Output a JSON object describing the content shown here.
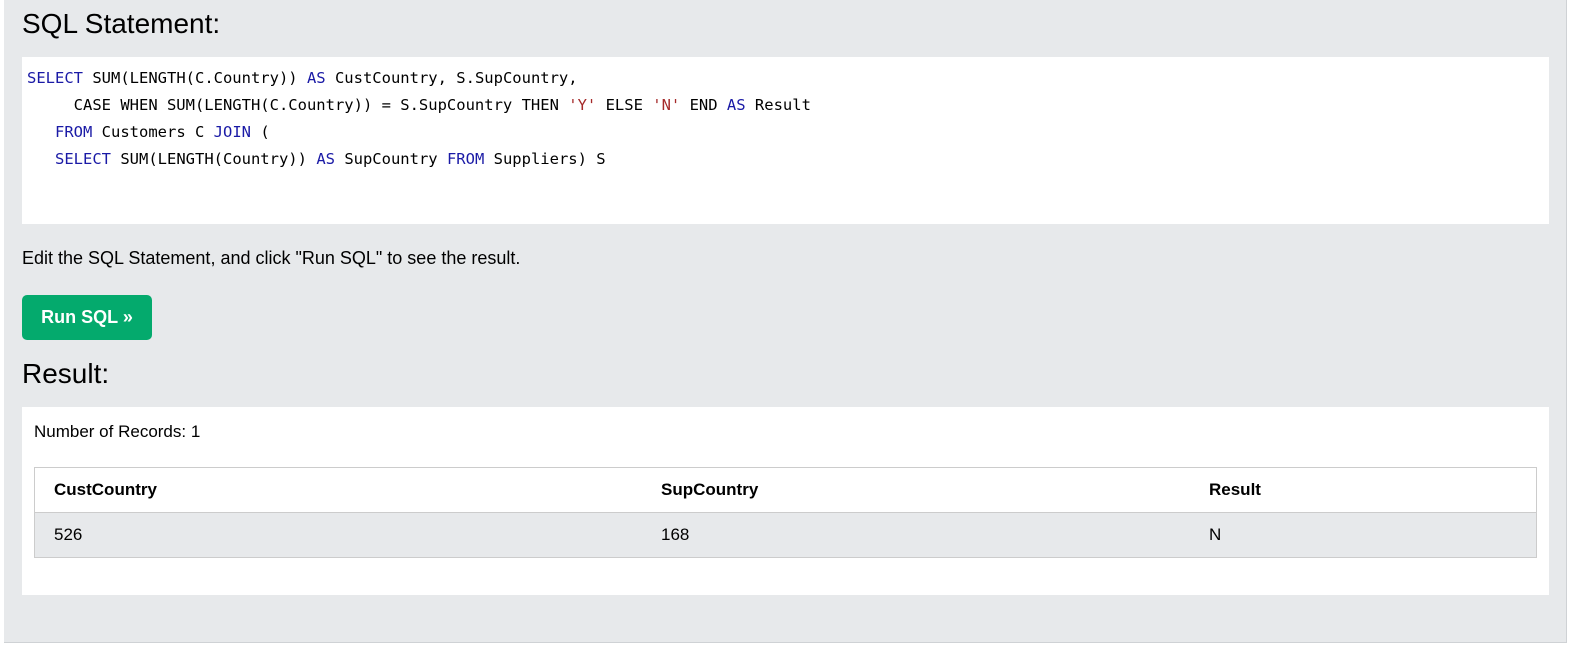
{
  "sql_section": {
    "title": "SQL Statement:",
    "code_lines": [
      [
        {
          "t": "SELECT",
          "k": "kw"
        },
        {
          "t": " SUM(LENGTH(C.Country)) ",
          "k": ""
        },
        {
          "t": "AS",
          "k": "kw"
        },
        {
          "t": " CustCountry, S.SupCountry,",
          "k": ""
        }
      ],
      [
        {
          "t": "     CASE WHEN SUM(LENGTH(C.Country)) = S.SupCountry THEN ",
          "k": ""
        },
        {
          "t": "'Y'",
          "k": "str"
        },
        {
          "t": " ELSE ",
          "k": ""
        },
        {
          "t": "'N'",
          "k": "str"
        },
        {
          "t": " END ",
          "k": ""
        },
        {
          "t": "AS",
          "k": "kw"
        },
        {
          "t": " Result",
          "k": ""
        }
      ],
      [
        {
          "t": "   ",
          "k": ""
        },
        {
          "t": "FROM",
          "k": "kw"
        },
        {
          "t": " Customers C ",
          "k": ""
        },
        {
          "t": "JOIN",
          "k": "kw"
        },
        {
          "t": " (",
          "k": ""
        }
      ],
      [
        {
          "t": "   ",
          "k": ""
        },
        {
          "t": "SELECT",
          "k": "kw"
        },
        {
          "t": " SUM(LENGTH(Country)) ",
          "k": ""
        },
        {
          "t": "AS",
          "k": "kw"
        },
        {
          "t": " SupCountry ",
          "k": ""
        },
        {
          "t": "FROM",
          "k": "kw"
        },
        {
          "t": " Suppliers) S",
          "k": ""
        }
      ]
    ]
  },
  "hint_text": "Edit the SQL Statement, and click \"Run SQL\" to see the result.",
  "run_button_label": "Run SQL »",
  "result_section": {
    "title": "Result:",
    "records_label": "Number of Records: 1",
    "columns": [
      "CustCountry",
      "SupCountry",
      "Result"
    ],
    "rows": [
      [
        "526",
        "168",
        "N"
      ]
    ]
  },
  "colors": {
    "run_button": "#04aa6d",
    "keyword": "#1a1aa6",
    "string": "#a52a2a",
    "panel_bg": "#e7e9eb"
  }
}
